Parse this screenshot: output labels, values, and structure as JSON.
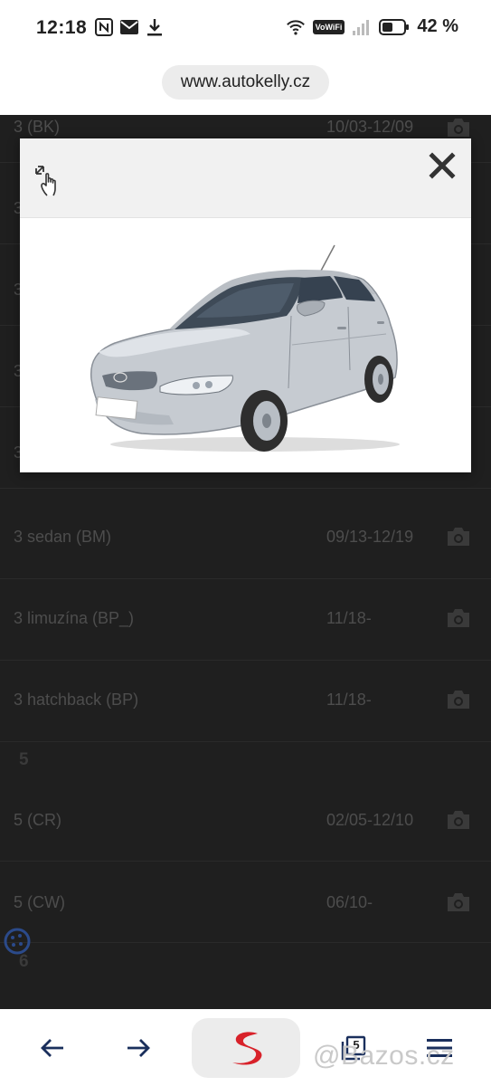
{
  "status_bar": {
    "time": "12:18",
    "wifi_badge": "VoWiFi",
    "battery": "42 %"
  },
  "browser": {
    "url": "www.autokelly.cz",
    "tabs_count": "5"
  },
  "list": {
    "rows": [
      {
        "name": "3 (BK)",
        "date": "10/03-12/09"
      },
      {
        "name": "3 sedan (BM)",
        "date": "09/13-12/19"
      },
      {
        "name": "3 limuzína (BP_)",
        "date": "11/18-"
      },
      {
        "name": "3 hatchback (BP)",
        "date": "11/18-"
      },
      {
        "name": "5 (CR)",
        "date": "02/05-12/10"
      },
      {
        "name": "5 (CW)",
        "date": "06/10-"
      }
    ],
    "partial_rows": [
      "3",
      "3",
      "3",
      "3"
    ],
    "group_5": "5",
    "group_6": "6"
  },
  "watermark": "@Bazos.cz",
  "icons": {
    "zoom": "zoom-gesture-icon",
    "close": "close-icon",
    "camera": "camera-icon"
  }
}
